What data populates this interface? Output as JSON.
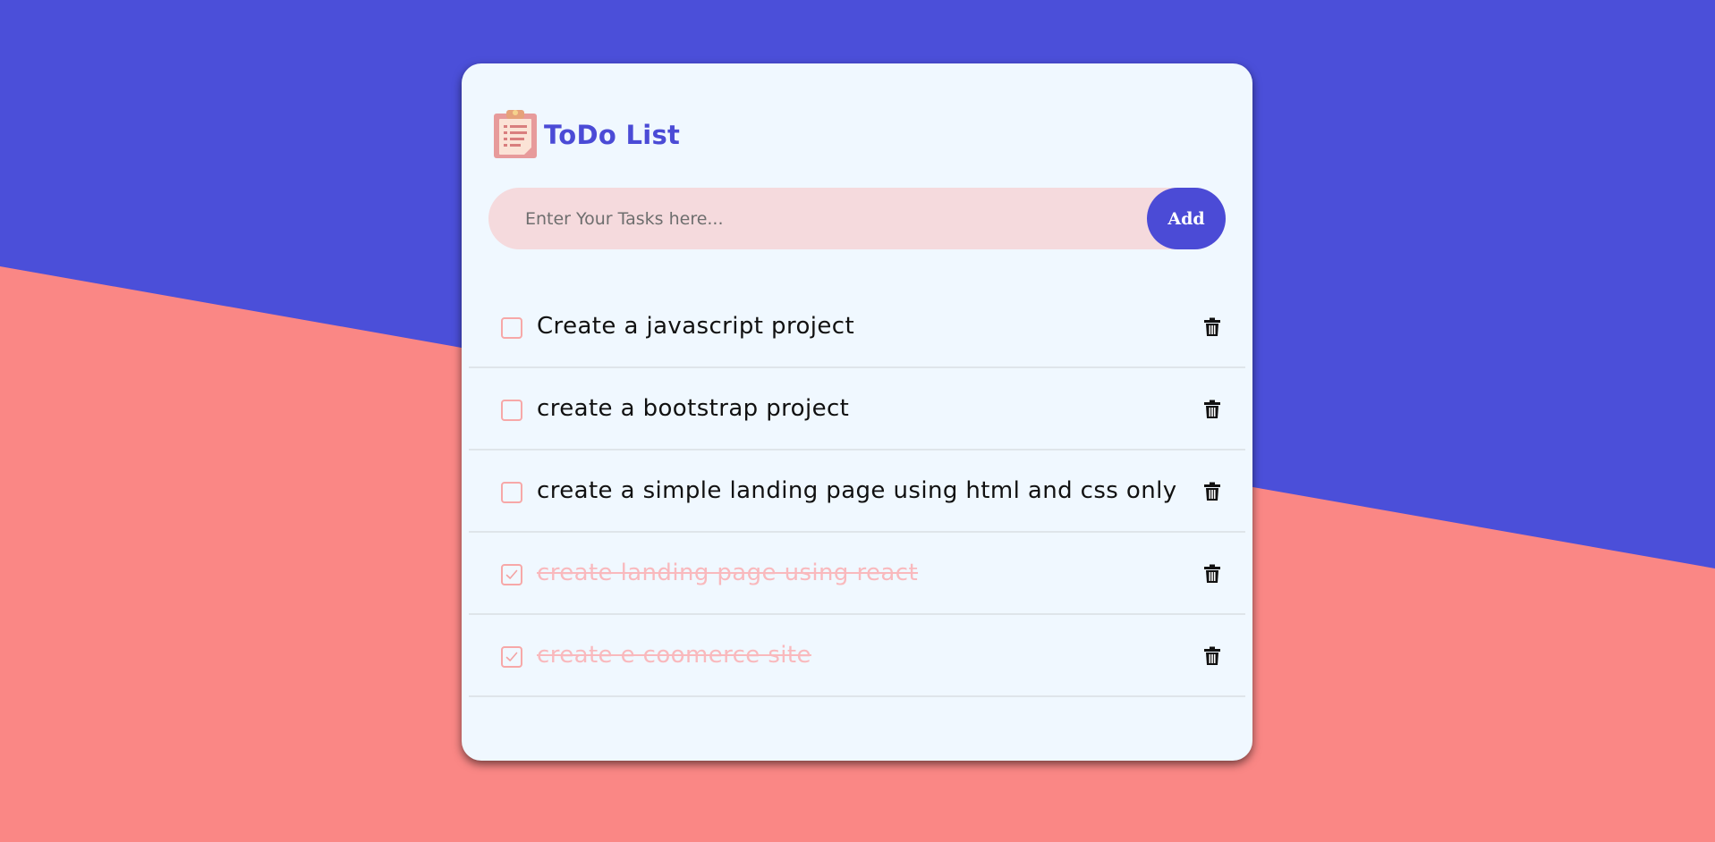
{
  "colors": {
    "top_background": "#4b4fd9",
    "bottom_background": "#fa8785",
    "card_background": "#f0f8ff",
    "accent": "#4b4bd6",
    "input_background": "#f5dadd",
    "done_text": "#f9b9bd",
    "checkbox_border": "#f7a8a8"
  },
  "app": {
    "title": "ToDo List",
    "logo_icon": "clipboard-checklist-icon"
  },
  "input": {
    "placeholder": "Enter Your Tasks here...",
    "value": "",
    "add_label": "Add"
  },
  "tasks": [
    {
      "text": "Create a javascript project",
      "done": false
    },
    {
      "text": "create a bootstrap project",
      "done": false
    },
    {
      "text": "create a simple landing page using html and css only",
      "done": false
    },
    {
      "text": "create landing page using react",
      "done": true
    },
    {
      "text": "create e coomerce site",
      "done": true
    }
  ],
  "icons": {
    "delete": "trash-icon",
    "check": "checkmark-icon"
  }
}
